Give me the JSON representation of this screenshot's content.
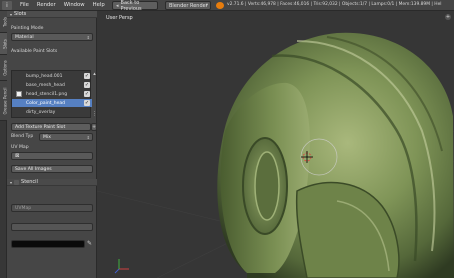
{
  "menubar": {
    "items": [
      "File",
      "Render",
      "Window",
      "Help"
    ],
    "back_label": "Back to Previous",
    "render_engine": "Blender Render",
    "stats": "v2.71.6 | Verts:46,978 | Faces:46,016 | Tris:92,032 | Objects:1/7 | Lamps:0/1 | Mem:139.89M | Hel"
  },
  "vertical_tabs": [
    "Tools",
    "Slots",
    "Options",
    "Grease Pencil"
  ],
  "slots_panel": {
    "title": "Slots",
    "painting_mode_label": "Painting Mode",
    "painting_mode_value": "Material",
    "available_slots_label": "Available Paint Slots",
    "slots": [
      {
        "name": "bump_head.001"
      },
      {
        "name": "base_mesh_head"
      },
      {
        "name": "head_stencil1.png"
      },
      {
        "name": "Color_paint_head"
      },
      {
        "name": "dirty_overlay"
      }
    ],
    "selected_index": 3,
    "add_slot_label": "Add Texture Paint Slot",
    "blend_type_label": "Blend Typ",
    "blend_type_value": "Mix",
    "uv_map_label": "UV Map",
    "save_all_label": "Save All Images"
  },
  "stencil_panel": {
    "title": "Stencil",
    "uvmap_value": "UVMap"
  },
  "viewport": {
    "label": "User Persp"
  }
}
